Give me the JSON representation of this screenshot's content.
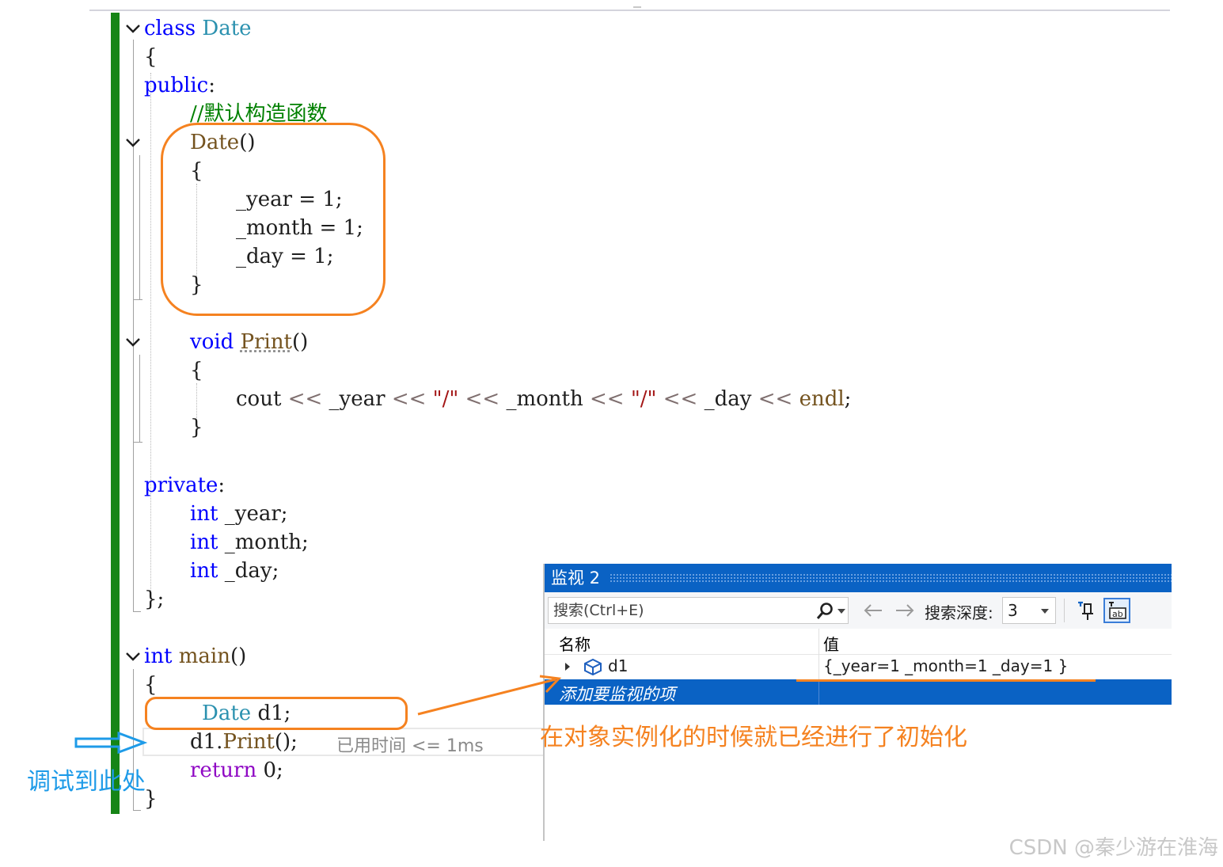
{
  "code": {
    "lines": {
      "l1": {
        "kw": "class",
        "name": "Date"
      },
      "l2": "{",
      "l3": {
        "kw": "public",
        "punc": ":"
      },
      "l4": "//默认构造函数",
      "l5": {
        "fn": "Date",
        "punc": "()"
      },
      "l6": "{",
      "l7": {
        "var": "_year",
        "rest": " = 1;"
      },
      "l8": {
        "var": "_month",
        "rest": " = 1;"
      },
      "l9": {
        "var": "_day",
        "rest": " = 1;"
      },
      "l10": "}",
      "l11": {
        "kw": "void",
        "fn": "Print",
        "punc": "()"
      },
      "l12": "{",
      "l13": {
        "a": "cout",
        "op": "<<",
        "v1": "_year",
        "s1": "\"/\"",
        "v2": "_month",
        "s2": "\"/\"",
        "v3": "_day",
        "e": "endl",
        "end": ";"
      },
      "l14": "}",
      "l15": {
        "kw": "private",
        "punc": ":"
      },
      "l16": {
        "kw": "int",
        "var": "_year;"
      },
      "l17": {
        "kw": "int",
        "var": "_month;"
      },
      "l18": {
        "kw": "int",
        "var": "_day;"
      },
      "l19": "};",
      "l20": {
        "kw": "int",
        "fn": "main",
        "punc": "()"
      },
      "l21": "{",
      "l22": {
        "ty": "Date",
        "rest": " d1;"
      },
      "l23": {
        "obj": "d1.",
        "fn": "Print",
        "rest": "();"
      },
      "l24": {
        "kw": "return",
        "rest": " 0;"
      },
      "l25": "}"
    },
    "elapsed": "已用时间 <= 1ms"
  },
  "watch": {
    "title": "监视 2",
    "search_placeholder": "搜索(Ctrl+E)",
    "depth_label": "搜索深度:",
    "depth_value": "3",
    "col_name": "名称",
    "col_value": "值",
    "row_name": "d1",
    "row_value": "{_year=1 _month=1 _day=1 }",
    "add_item": "添加要监视的项"
  },
  "annotations": {
    "debug_here": "调试到此处",
    "note": "在对象实例化的时候就已经进行了初始化"
  },
  "watermark": "CSDN @秦少游在淮海",
  "colors": {
    "keyword": "#0000ff",
    "type": "#2b91af",
    "comment": "#008000",
    "string": "#a31515",
    "accent_orange": "#f58220",
    "accent_blue": "#1e9be8",
    "watch_title_bg": "#0a62c4"
  }
}
